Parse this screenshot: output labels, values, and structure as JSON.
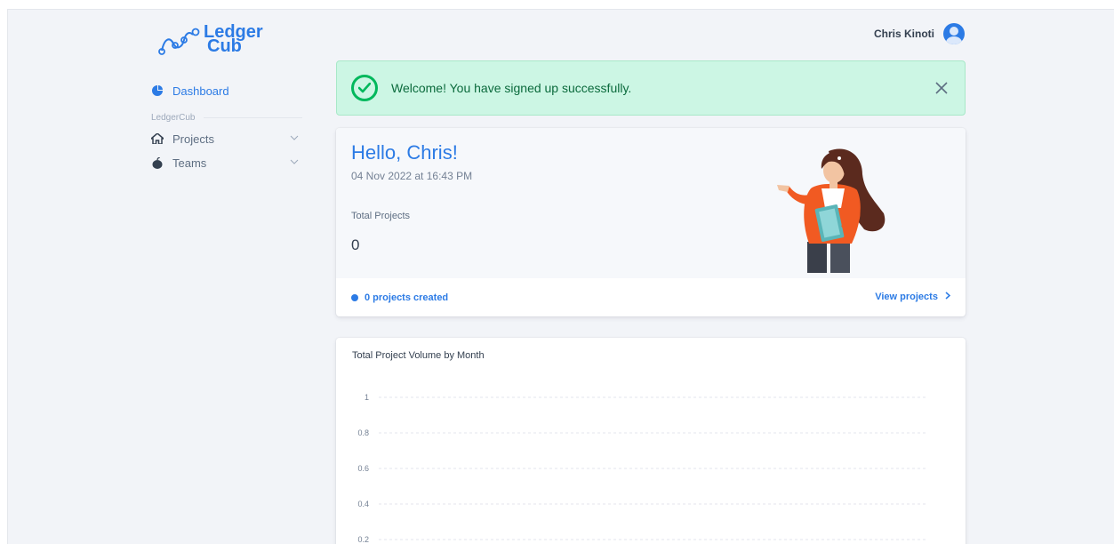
{
  "app": {
    "logo_line1": "Ledger",
    "logo_line2": "Cub",
    "user_name": "Chris Kinoti"
  },
  "sidebar": {
    "dashboard_label": "Dashboard",
    "section_label": "LedgerCub",
    "items": [
      {
        "label": "Projects",
        "icon": "home-icon"
      },
      {
        "label": "Teams",
        "icon": "apple-icon"
      }
    ]
  },
  "alert": {
    "message": "Welcome! You have signed up successfully."
  },
  "hello": {
    "title": "Hello, Chris!",
    "date": "04 Nov 2022 at 16:43 PM",
    "total_projects_label": "Total Projects",
    "total_projects_value": "0",
    "projects_created": "0 projects created",
    "view_projects": "View projects"
  },
  "colors": {
    "accent": "#2c7be5",
    "success_bg": "#ccf6e4",
    "success": "#00b85c"
  },
  "chart_data": {
    "type": "line",
    "title": "Total Project Volume by Month",
    "y_ticks": [
      "1",
      "0.8",
      "0.6",
      "0.4",
      "0.2"
    ],
    "ylim": [
      0,
      1
    ],
    "grid": true,
    "series": []
  }
}
